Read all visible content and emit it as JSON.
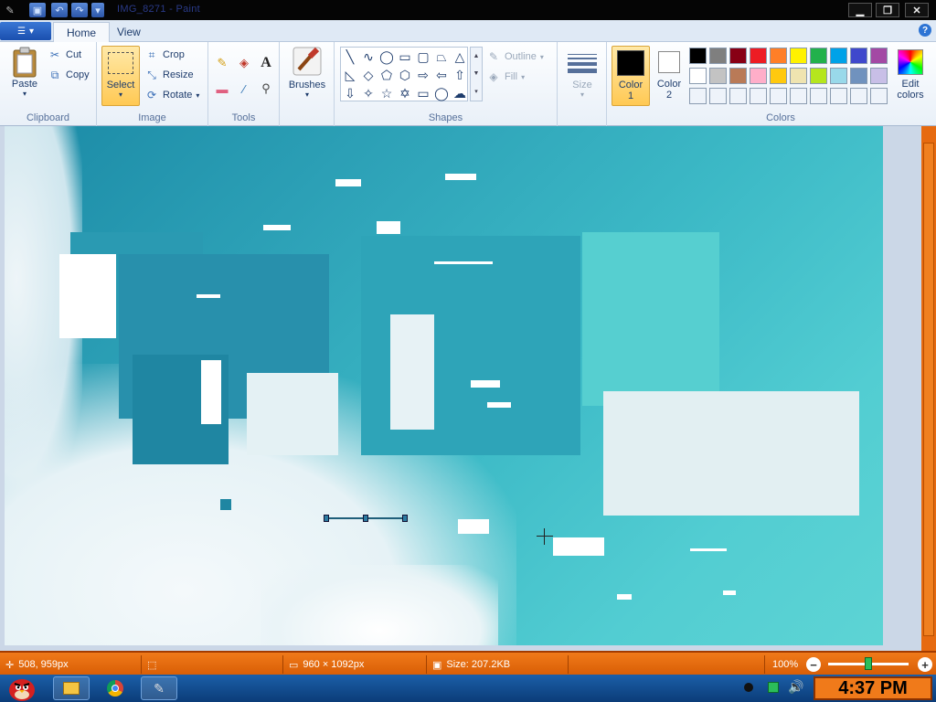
{
  "window": {
    "title": "IMG_8271 - Paint",
    "quick_access": [
      "save-icon",
      "undo-icon",
      "redo-icon",
      "customize-icon"
    ]
  },
  "tabs": {
    "file_label": "",
    "home": "Home",
    "view": "View"
  },
  "ribbon": {
    "clipboard": {
      "label": "Clipboard",
      "paste": "Paste",
      "cut": "Cut",
      "copy": "Copy"
    },
    "image": {
      "label": "Image",
      "select": "Select",
      "crop": "Crop",
      "resize": "Resize",
      "rotate": "Rotate"
    },
    "tools": {
      "label": "Tools"
    },
    "brushes": {
      "label": "Brushes"
    },
    "shapes": {
      "label": "Shapes",
      "outline": "Outline",
      "fill": "Fill"
    },
    "size": {
      "label": "Size"
    },
    "colors": {
      "label": "Colors",
      "color1": "Color\n1",
      "color1_line1": "Color",
      "color1_line2": "1",
      "color2_line1": "Color",
      "color2_line2": "2",
      "edit": "Edit colors",
      "edit_line1": "Edit",
      "edit_line2": "colors",
      "color1_value": "#000000",
      "color2_value": "#ffffff",
      "palette": [
        "#000000",
        "#7f7f7f",
        "#880015",
        "#ed1c24",
        "#ff7f27",
        "#fff200",
        "#22b14c",
        "#00a2e8",
        "#3f48cc",
        "#a349a4",
        "#ffffff",
        "#c3c3c3",
        "#b97a57",
        "#ffaec9",
        "#ffc90e",
        "#efe4b0",
        "#b5e61d",
        "#99d9ea",
        "#7092be",
        "#c8bfe7"
      ]
    }
  },
  "status": {
    "cursor_pos": "508, 959px",
    "image_size": "960 × 1092px",
    "file_size": "Size: 207.2KB",
    "zoom": "100%",
    "zoom_level": 1.0
  },
  "taskbar": {
    "apps": [
      "angry-birds-icon",
      "folder-icon",
      "chrome-icon",
      "paint-icon"
    ],
    "clock": "4:37 PM"
  }
}
